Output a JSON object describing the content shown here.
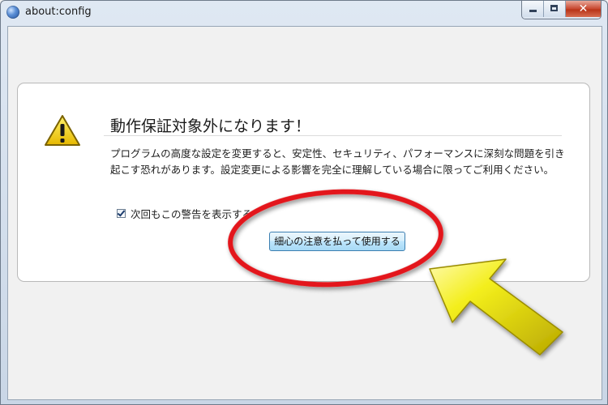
{
  "window": {
    "title": "about:config",
    "close_glyph": "✕"
  },
  "warning": {
    "title": "動作保証対象外になります！",
    "message": "プログラムの高度な設定を変更すると、安定性、セキュリティ、パフォーマンスに深刻な問題を引き起こす恐れがあります。設定変更による影響を完全に理解している場合に限ってご利用ください。",
    "checkbox_label": "次回もこの警告を表示する",
    "checkbox_checked": true,
    "button_label": "細心の注意を払って使用する"
  },
  "icons": {
    "app": "firefox-globe-icon",
    "warning": "warning-triangle-icon",
    "annotation_arrow": "yellow-arrow",
    "annotation_circle": "red-ellipse"
  },
  "colors": {
    "accent_button": "#bee6fd",
    "annotation_red": "#e3151a",
    "annotation_yellow": "#f2ef1a"
  }
}
